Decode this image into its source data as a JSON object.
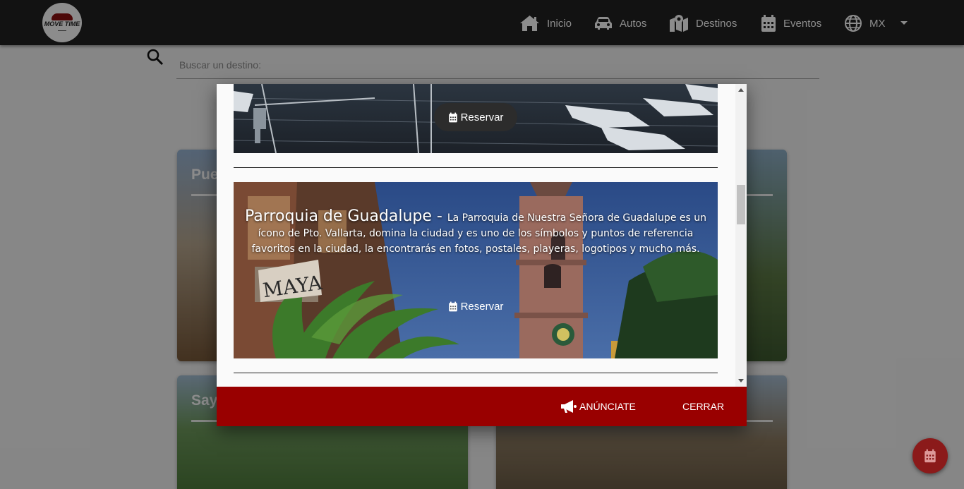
{
  "navbar": {
    "logo_text": "MOVE TIME",
    "items": [
      {
        "label": "Inicio",
        "icon": "home-icon"
      },
      {
        "label": "Autos",
        "icon": "car-icon"
      },
      {
        "label": "Destinos",
        "icon": "map-icon"
      },
      {
        "label": "Eventos",
        "icon": "calendar-icon"
      },
      {
        "label": "MX",
        "icon": "globe-icon"
      }
    ]
  },
  "search": {
    "placeholder": "Buscar un destino:"
  },
  "background_cards": [
    {
      "title": "Pue"
    },
    {
      "title": "Say"
    }
  ],
  "modal": {
    "places": [
      {
        "reserve_label": "Reservar"
      },
      {
        "name": "Parroquia de Guadalupe -",
        "description": "La Parroquia de Nuestra Señora de Guadalupe es un ícono de Pto. Vallarta, domina la ciudad y es uno de los símbolos y puntos de referencia favoritos en la ciudad, la encontrarás en fotos, postales, playeras, logotipos y mucho más.",
        "reserve_label": "Reservar"
      }
    ],
    "footer": {
      "advertise_label": "ANÚNCIATE",
      "close_label": "CERRAR"
    }
  },
  "colors": {
    "navbar": "#212121",
    "footer": "#990000",
    "fab": "#8b1a1a"
  }
}
